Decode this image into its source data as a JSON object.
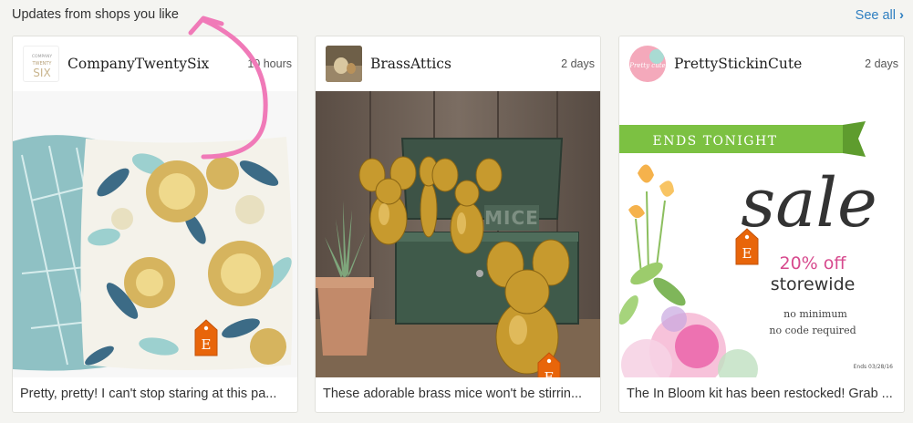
{
  "header": {
    "title": "Updates from shops you like",
    "see_all": "See all",
    "see_all_icon": "chevron-right-icon"
  },
  "cards": [
    {
      "shop": "CompanyTwentySix",
      "time": "10 hours",
      "caption": "Pretty, pretty! I can't stop staring at this pa...",
      "avatar_text": [
        "COMPANY",
        "TWENTY",
        "SIX"
      ]
    },
    {
      "shop": "BrassAttics",
      "time": "2 days",
      "caption": "These adorable brass mice won't be stirrin...",
      "mice_label": "MICE"
    },
    {
      "shop": "PrettyStickinCute",
      "time": "2 days",
      "caption": "The In Bloom kit has been restocked! Grab ...",
      "avatar_text": "Pretty cute",
      "banner": "ENDS TONIGHT",
      "sale_word": "sale",
      "off_line1": "20% off",
      "off_line2": "storewide",
      "note1": "no minimum",
      "note2": "no code required",
      "ends": "Ends 03/28/16"
    }
  ],
  "etsy_tag_letter": "E",
  "colors": {
    "link": "#2f7fc1",
    "etsy_orange": "#e8650a",
    "banner_green": "#7cc142",
    "arrow_pink": "#f07ab8"
  }
}
